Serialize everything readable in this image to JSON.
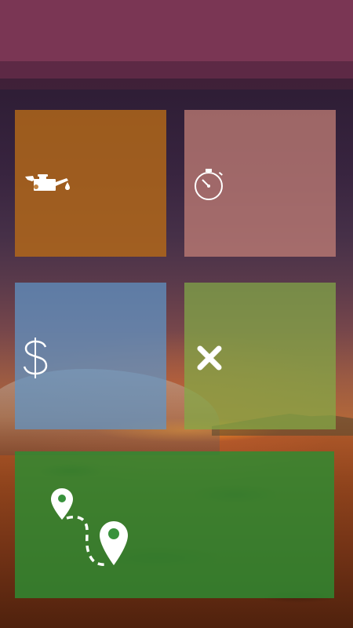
{
  "app": {
    "tiles": [
      {
        "id": "oil",
        "icon": "oil-can-icon"
      },
      {
        "id": "timer",
        "icon": "stopwatch-icon"
      },
      {
        "id": "money",
        "icon": "dollar-icon"
      },
      {
        "id": "cancel",
        "icon": "close-icon"
      },
      {
        "id": "route",
        "icon": "route-map-pin-icon"
      }
    ]
  },
  "colors": {
    "top_bar": "#7a3654",
    "oil_tile": "#b46919",
    "timer_tile": "#c88278",
    "money_tile": "#5f96c8",
    "cancel_tile": "#82aa46",
    "route_tile": "#2d8c32",
    "icon": "#ffffff"
  }
}
